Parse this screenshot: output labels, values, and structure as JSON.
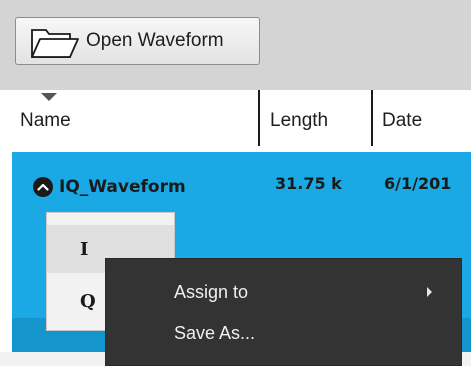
{
  "toolbar": {
    "open_label": "Open Waveform",
    "open_icon": "folder-open-icon"
  },
  "table": {
    "columns": [
      "Name",
      "Length",
      "Date"
    ],
    "sort_indicator": "sort-descending-icon"
  },
  "waveform": {
    "name": "IQ_Waveform",
    "length": "31.75 k",
    "date": "6/1/201",
    "expand_icon": "collapse-up-icon",
    "children": [
      "I",
      "Q"
    ]
  },
  "context_menu": {
    "items": [
      "Assign to",
      "Save As..."
    ],
    "submenu_icon": "submenu-arrow-icon"
  },
  "colors": {
    "selection": "#1aa9e4",
    "menu_bg": "#333333",
    "toolbar_bg": "#d4d4d4"
  }
}
